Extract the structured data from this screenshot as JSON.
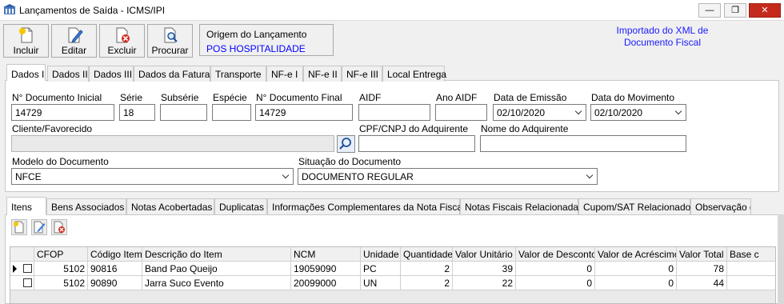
{
  "window": {
    "title": "Lançamentos de Saída - ICMS/IPI",
    "minimize": "—",
    "restore": "❐",
    "close": "✕"
  },
  "toolbar": {
    "incluir": "Incluir",
    "editar": "Editar",
    "excluir": "Excluir",
    "procurar": "Procurar"
  },
  "origem": {
    "title": "Origem do Lançamento",
    "value": "POS HOSPITALIDADE"
  },
  "import_note_line1": "Importado do XML de",
  "import_note_line2": "Documento Fiscal",
  "tabs": [
    "Dados I",
    "Dados II",
    "Dados III",
    "Dados da Fatura",
    "Transporte",
    "NF-e I",
    "NF-e II",
    "NF-e III",
    "Local Entrega"
  ],
  "form": {
    "doc_inicial_label": "N° Documento Inicial",
    "doc_inicial": "14729",
    "serie_label": "Série",
    "serie": "18",
    "subserie_label": "Subsérie",
    "subserie": "",
    "especie_label": "Espécie",
    "especie": "",
    "doc_final_label": "N° Documento Final",
    "doc_final": "14729",
    "aidf_label": "AIDF",
    "aidf": "",
    "ano_aidf_label": "Ano AIDF",
    "ano_aidf": "",
    "data_emissao_label": "Data de Emissão",
    "data_emissao": "02/10/2020",
    "data_movimento_label": "Data do Movimento",
    "data_movimento": "02/10/2020",
    "cliente_label": "Cliente/Favorecido",
    "cliente": "",
    "cpf_label": "CPF/CNPJ do Adquirente",
    "cpf": "",
    "nome_label": "Nome do Adquirente",
    "nome": "",
    "modelo_label": "Modelo do Documento",
    "modelo": "NFCE",
    "situacao_label": "Situação do Documento",
    "situacao": "DOCUMENTO REGULAR"
  },
  "tabs2": [
    "Itens",
    "Bens Associados",
    "Notas Acobertadas",
    "Duplicatas",
    "Informações Complementares da Nota Fiscal",
    "Notas Fiscais Relacionadas",
    "Cupom/SAT Relacionados",
    "Observação d"
  ],
  "grid": {
    "headers": [
      "CFOP",
      "Código Item",
      "Descrição do Item",
      "NCM",
      "Unidade",
      "Quantidade",
      "Valor Unitário",
      "Valor de Desconto",
      "Valor de Acréscimo",
      "Valor Total",
      "Base c"
    ],
    "rows": [
      [
        "5102",
        "90816",
        "Band Pao Queijo",
        "19059090",
        "PC",
        "2",
        "39",
        "0",
        "0",
        "78"
      ],
      [
        "5102",
        "90890",
        "Jarra Suco Evento",
        "20099000",
        "UN",
        "2",
        "22",
        "0",
        "0",
        "44"
      ]
    ]
  }
}
